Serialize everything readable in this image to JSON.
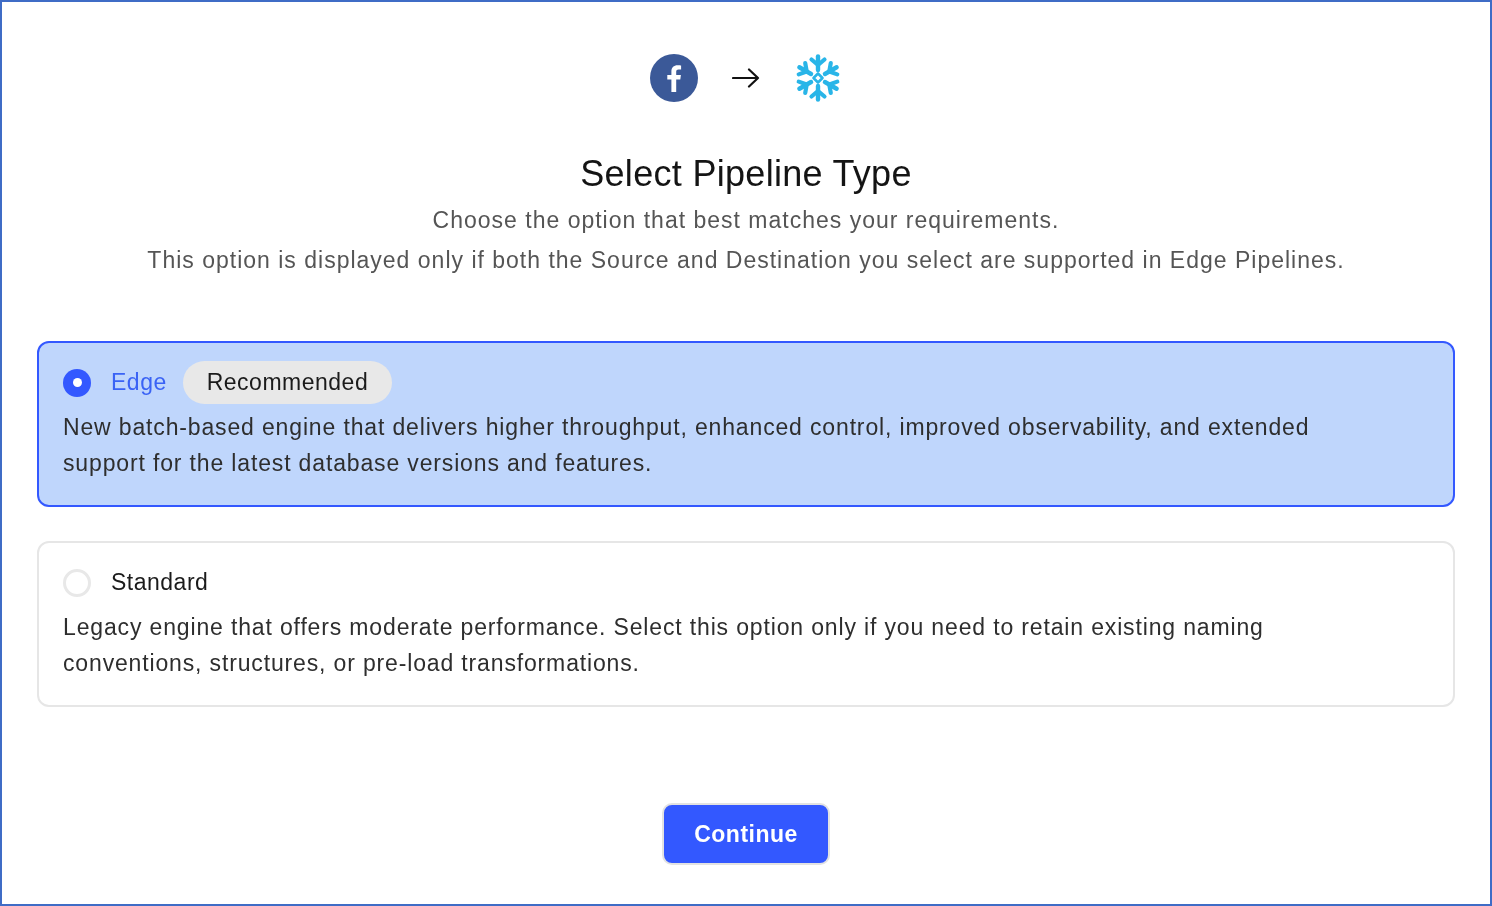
{
  "title": "Select Pipeline Type",
  "subtitle_lines": [
    "Choose the option that best matches your requirements.",
    "This option is displayed only if both the Source and Destination you select are supported in Edge Pipelines."
  ],
  "options": [
    {
      "label": "Edge",
      "badge": "Recommended",
      "description": "New batch-based engine that delivers higher throughput, enhanced control, improved observability, and extended support for the latest database versions and features.",
      "selected": true
    },
    {
      "label": "Standard",
      "description": "Legacy engine that offers moderate performance. Select this option only if you need to retain existing naming conventions, structures, or pre-load transformations.",
      "selected": false
    }
  ],
  "buttons": [
    {
      "label": "Continue"
    }
  ]
}
